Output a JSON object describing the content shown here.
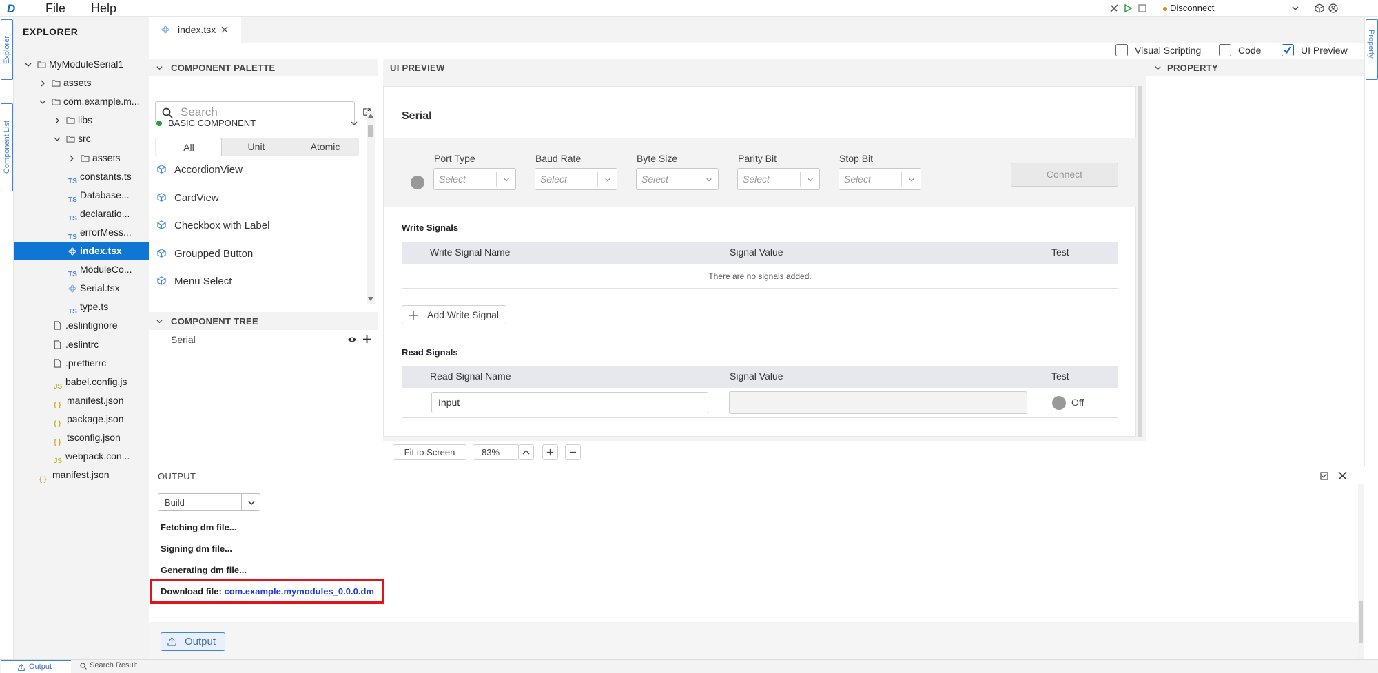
{
  "menubar": {
    "logo": "D",
    "menus": [
      "File",
      "Help"
    ],
    "device_status": "Disconnect",
    "status_color": "#e08a1e"
  },
  "activity": {
    "tabs": [
      "Explorer",
      "Component List"
    ]
  },
  "explorer": {
    "title": "EXPLORER",
    "items": [
      {
        "label": "MyModuleSerial1",
        "icon": "folder-icon"
      },
      {
        "label": "assets",
        "icon": "folder-icon"
      },
      {
        "label": "com.example.m...",
        "icon": "folder-icon"
      },
      {
        "label": "libs",
        "icon": "folder-icon"
      },
      {
        "label": "src",
        "icon": "folder-icon"
      },
      {
        "label": "assets",
        "icon": "folder-icon"
      },
      {
        "label": "constants.ts",
        "icon": "ts-file-icon",
        "badge": "TS"
      },
      {
        "label": "Database...",
        "icon": "ts-file-icon",
        "badge": "TS"
      },
      {
        "label": "declaratio...",
        "icon": "ts-file-icon",
        "badge": "TS"
      },
      {
        "label": "errorMess...",
        "icon": "ts-file-icon",
        "badge": "TS"
      },
      {
        "label": "index.tsx",
        "icon": "react-file-icon"
      },
      {
        "label": "ModuleCo...",
        "icon": "ts-file-icon",
        "badge": "TS"
      },
      {
        "label": "Serial.tsx",
        "icon": "react-file-icon"
      },
      {
        "label": "type.ts",
        "icon": "ts-file-icon",
        "badge": "TS"
      },
      {
        "label": ".eslintignore",
        "icon": "file-icon"
      },
      {
        "label": ".eslintrc",
        "icon": "file-icon"
      },
      {
        "label": ".prettierrc",
        "icon": "file-icon"
      },
      {
        "label": "babel.config.js",
        "icon": "js-file-icon",
        "badge": "JS"
      },
      {
        "label": "manifest.json",
        "icon": "json-file-icon",
        "badge": "{ }"
      },
      {
        "label": "package.json",
        "icon": "json-file-icon",
        "badge": "{ }"
      },
      {
        "label": "tsconfig.json",
        "icon": "json-file-icon",
        "badge": "{ }"
      },
      {
        "label": "webpack.con...",
        "icon": "js-file-icon",
        "badge": "JS"
      },
      {
        "label": "manifest.json",
        "icon": "json-file-icon",
        "badge": "{ }"
      }
    ]
  },
  "editor_tab": {
    "label": "index.tsx"
  },
  "view_toggles": [
    {
      "label": "Visual Scripting",
      "checked": false
    },
    {
      "label": "Code",
      "checked": false
    },
    {
      "label": "UI Preview",
      "checked": true
    }
  ],
  "palette": {
    "title": "COMPONENT PALETTE",
    "search_placeholder": "Search",
    "group": "BASIC COMPONENT",
    "filters": [
      "All",
      "Unit",
      "Atomic"
    ],
    "components": [
      "AccordionView",
      "CardView",
      "Checkbox with Label",
      "Groupped Button",
      "Menu Select"
    ]
  },
  "tree": {
    "title": "COMPONENT TREE",
    "root": "Serial"
  },
  "preview": {
    "title": "UI PREVIEW",
    "component_title": "Serial",
    "fields": [
      {
        "label": "Port Type",
        "value": "Select"
      },
      {
        "label": "Baud Rate",
        "value": "Select"
      },
      {
        "label": "Byte Size",
        "value": "Select"
      },
      {
        "label": "Parity Bit",
        "value": "Select"
      },
      {
        "label": "Stop Bit",
        "value": "Select"
      }
    ],
    "connect_label": "Connect",
    "write": {
      "title": "Write Signals",
      "columns": [
        "Write Signal Name",
        "Signal Value",
        "Test"
      ],
      "empty": "There are no signals added.",
      "add_label": "Add Write Signal"
    },
    "read": {
      "title": "Read Signals",
      "columns": [
        "Read Signal Name",
        "Signal Value",
        "Test"
      ],
      "row_name": "Input",
      "row_value": "",
      "toggle_label": "Off"
    },
    "fit_label": "Fit to Screen",
    "zoom": "83%"
  },
  "property": {
    "title": "PROPERTY"
  },
  "output": {
    "title": "OUTPUT",
    "channel": "Build",
    "lines": [
      "Fetching dm file...",
      "Signing dm file...",
      "Generating dm file..."
    ],
    "download_label": "Download file:",
    "download_link": "com.example.mymodules_0.0.0.dm",
    "highlight_color": "#e3131b",
    "button_label": "Output"
  },
  "statusbar": {
    "tabs": [
      "Output",
      "Search Result"
    ]
  }
}
